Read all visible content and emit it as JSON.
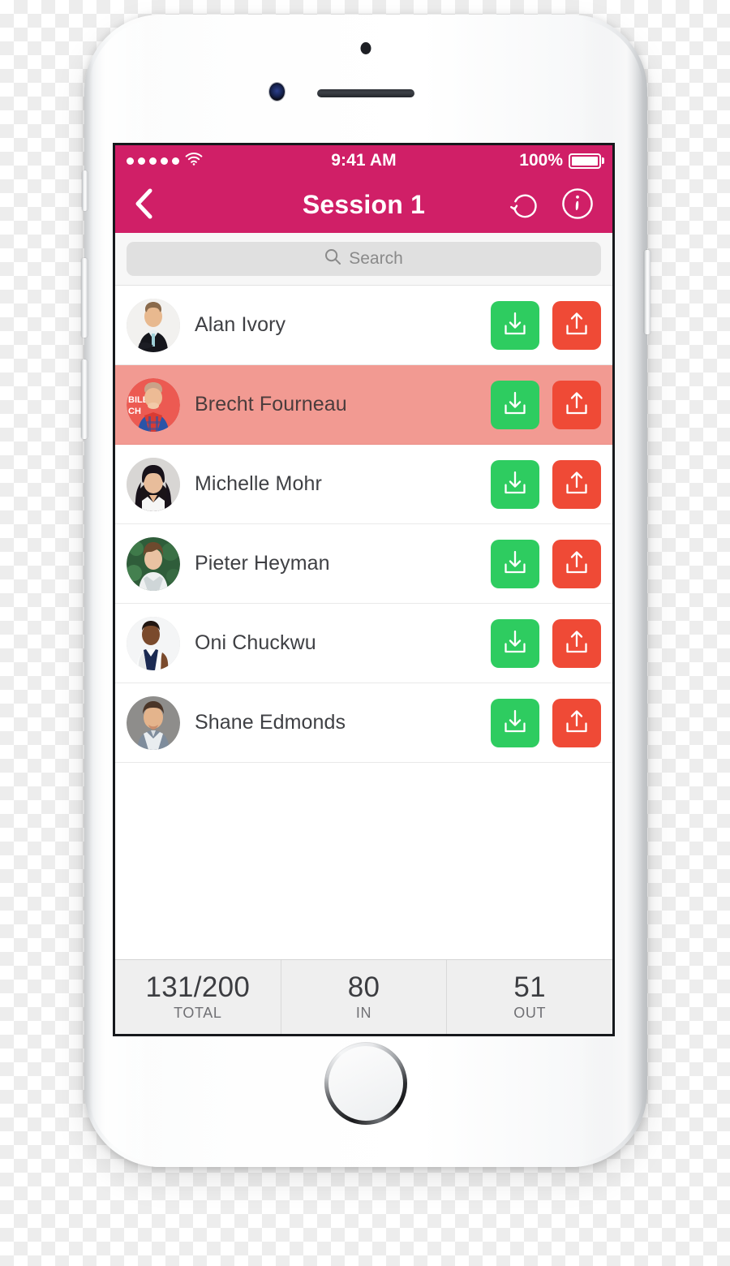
{
  "theme": {
    "brand": "#d01f67",
    "in_color": "#2ecc60",
    "out_color": "#ef4a36",
    "selected_row_bg": "#f29a92",
    "screen_bg": "#ffffff"
  },
  "status_bar": {
    "signal_icon": "signal-dots-icon",
    "signal_bars": 5,
    "wifi_icon": "wifi-icon",
    "time": "9:41 AM",
    "battery_percent": "100%",
    "battery_icon": "battery-full-icon"
  },
  "nav_bar": {
    "back_icon": "chevron-left-icon",
    "title": "Session 1",
    "reset_icon": "undo-circle-icon",
    "info_icon": "info-circle-icon"
  },
  "search": {
    "icon": "search-icon",
    "placeholder": "Search",
    "value": ""
  },
  "list": {
    "check_in_icon": "download-tray-icon",
    "check_out_icon": "upload-tray-icon",
    "rows": [
      {
        "name": "Alan Ivory",
        "avatar": "avatar-alan-ivory",
        "selected": false
      },
      {
        "name": "Brecht Fourneau",
        "avatar": "avatar-brecht-fourneau",
        "selected": true
      },
      {
        "name": "Michelle Mohr",
        "avatar": "avatar-michelle-mohr",
        "selected": false
      },
      {
        "name": "Pieter Heyman",
        "avatar": "avatar-pieter-heyman",
        "selected": false
      },
      {
        "name": "Oni Chuckwu",
        "avatar": "avatar-oni-chuckwu",
        "selected": false
      },
      {
        "name": "Shane Edmonds",
        "avatar": "avatar-shane-edmonds",
        "selected": false
      }
    ]
  },
  "stats": [
    {
      "value": "131/200",
      "label": "TOTAL"
    },
    {
      "value": "80",
      "label": "IN"
    },
    {
      "value": "51",
      "label": "OUT"
    }
  ],
  "device": {
    "front_camera_icon": "front-camera-icon",
    "earpiece_icon": "earpiece-speaker-icon",
    "mic_icon": "microphone-icon",
    "home_button_icon": "home-button-icon",
    "power_button_icon": "power-button",
    "volume_up_icon": "volume-up-button",
    "volume_down_icon": "volume-down-button",
    "silent_switch_icon": "silent-switch"
  }
}
